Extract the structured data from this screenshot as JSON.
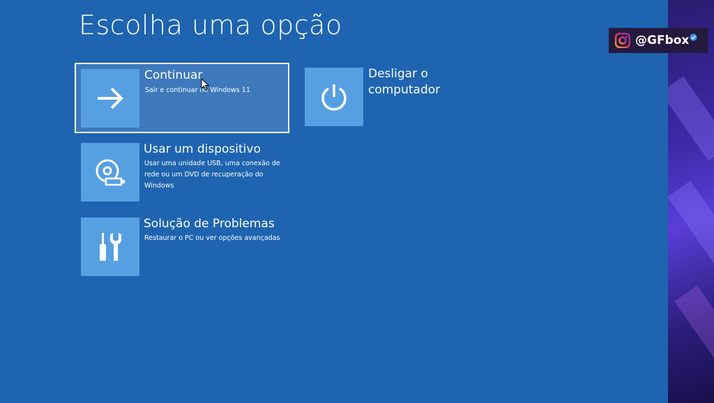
{
  "page": {
    "title": "Escolha uma opção"
  },
  "options": [
    {
      "id": "continuar",
      "title": "Continuar",
      "description": "Sair e continuar no Windows 11",
      "icon": "arrow-right-icon",
      "selected": true
    },
    {
      "id": "desligar",
      "title": "Desligar o\ncomputador",
      "description": "",
      "icon": "power-icon",
      "selected": false
    },
    {
      "id": "dispositivo",
      "title": "Usar um dispositivo",
      "description": "Usar uma unidade USB, uma conexão de rede ou um DVD de recuperação do Windows",
      "icon": "disc-usb-icon",
      "selected": false
    },
    {
      "id": "solucao",
      "title": "Solução de Problemas",
      "description": "Restaurar o PC ou ver opções avançadas",
      "icon": "tools-icon",
      "selected": false
    }
  ],
  "overlay": {
    "handle": "@GFbox",
    "icon": "instagram-icon",
    "verified_icon": "verified-check-icon"
  },
  "colors": {
    "background": "#1e64b0",
    "tile": "#56a0e2",
    "text": "#ffffff",
    "badge_bg": "#241a3e"
  }
}
